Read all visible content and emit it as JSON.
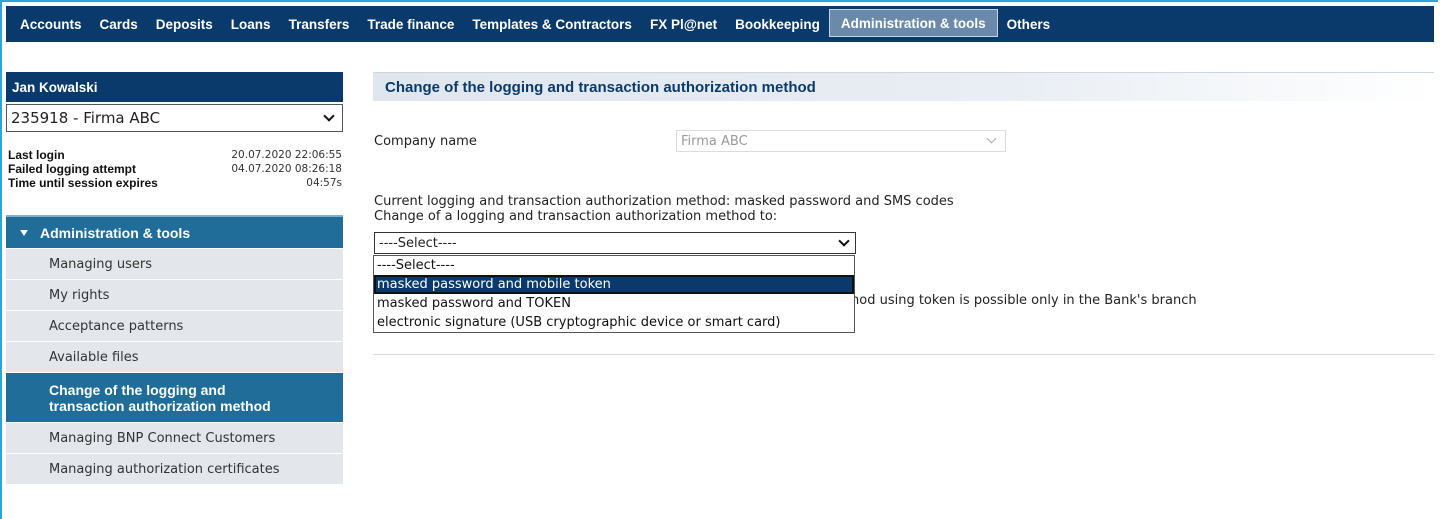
{
  "nav": {
    "items": [
      {
        "label": "Accounts"
      },
      {
        "label": "Cards"
      },
      {
        "label": "Deposits"
      },
      {
        "label": "Loans"
      },
      {
        "label": "Transfers"
      },
      {
        "label": "Trade finance"
      },
      {
        "label": "Templates & Contractors"
      },
      {
        "label": "FX Pl@net"
      },
      {
        "label": "Bookkeeping"
      },
      {
        "label": "Administration & tools"
      },
      {
        "label": "Others"
      }
    ],
    "active_index": 9
  },
  "sidebar": {
    "user_name": "Jan Kowalski",
    "company_selected": "235918 - Firma ABC",
    "session": [
      {
        "label": "Last login",
        "value": "20.07.2020 22:06:55"
      },
      {
        "label": "Failed logging attempt",
        "value": "04.07.2020 08:26:18"
      },
      {
        "label": "Time until session expires",
        "value": "04:57s"
      }
    ],
    "section_title": "Administration & tools",
    "menu": [
      {
        "label": "Managing users"
      },
      {
        "label": "My rights"
      },
      {
        "label": "Acceptance patterns"
      },
      {
        "label": "Available files"
      },
      {
        "label": "Change of the logging and\ntransaction authorization method",
        "active": true
      },
      {
        "label": "Managing BNP Connect Customers"
      },
      {
        "label": "Managing authorization certificates"
      }
    ]
  },
  "main": {
    "title": "Change of the logging and transaction authorization method",
    "company_label": "Company name",
    "company_value": "Firma ABC",
    "current_method": "Current logging and transaction authorization method: masked password and SMS codes",
    "change_label": "Change of a logging and transaction authorization method to:",
    "select_value": "----Select----",
    "options": [
      "----Select----",
      "masked password and mobile token",
      "masked password and TOKEN",
      "electronic signature (USB cryptographic device or smart card)"
    ],
    "highlighted_option": 1,
    "info_text": "hod using token is possible only in the Bank's branch"
  },
  "colors": {
    "nav_bg": "#0a3a6b",
    "nav_active": "#6b8aa9",
    "sidebar_active": "#1f6d98",
    "menu_bg": "#e3e6ea",
    "frame_border": "#2aa7d8"
  }
}
